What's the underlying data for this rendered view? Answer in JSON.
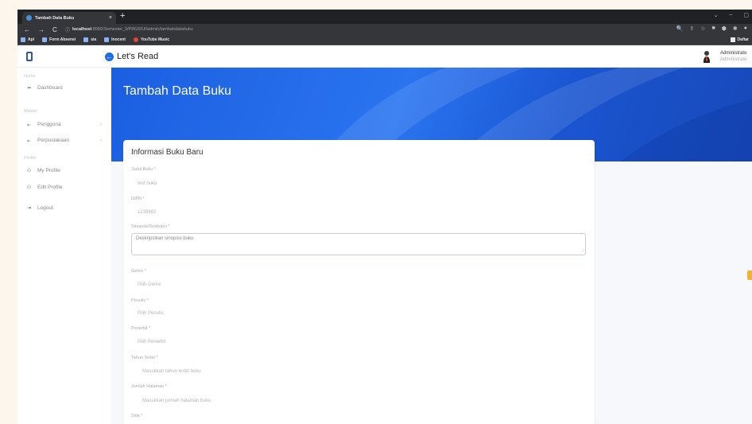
{
  "browser": {
    "tab_title": "Tambah Data Buku",
    "tab_close": "×",
    "new_tab": "+",
    "window_controls": [
      "⌄",
      "–",
      "▢"
    ],
    "nav": {
      "back": "←",
      "forward": "→",
      "reload": "C"
    },
    "url_info_icon": "ⓘ",
    "url_host": "localhost",
    "url_path": ":8080/Semester_3/PRG5/UI/admin/tambahdatabuku",
    "right_icons": [
      "🔍",
      "⇪",
      "☆",
      "■",
      "⬢",
      "✱",
      "●"
    ]
  },
  "bookmarks": {
    "items": [
      {
        "label": "Apl",
        "icon": "apps-grid-icon"
      },
      {
        "label": "Form Absensi",
        "icon": "bookmark-icon"
      },
      {
        "label": "sia",
        "icon": "bookmark-icon"
      },
      {
        "label": "Inocent",
        "icon": "bookmark-icon"
      },
      {
        "label": "YouTube Music",
        "icon": "youtube-music-icon"
      }
    ],
    "right_label": "Daftar"
  },
  "topbar": {
    "back_glyph": "←",
    "brand": "Let's Read",
    "user_name": "Administrato",
    "user_role": "Administrato"
  },
  "sidebar": {
    "sections": [
      {
        "title": "Home"
      },
      {
        "title": "Master"
      },
      {
        "title": "Profile"
      }
    ],
    "items": [
      {
        "label": "Dashboard",
        "icon": "dashboard-icon",
        "glyph": "▪▪",
        "chev": ""
      },
      {
        "label": "Pengguna",
        "icon": "users-icon",
        "glyph": "⁎.",
        "chev": "›"
      },
      {
        "label": "Perpustakaan",
        "icon": "library-icon",
        "glyph": "⁎.",
        "chev": "›"
      },
      {
        "label": "My Profile",
        "icon": "profile-icon",
        "glyph": "⚇",
        "chev": ""
      },
      {
        "label": "Edit Profile",
        "icon": "edit-profile-icon",
        "glyph": "⚇",
        "chev": ""
      },
      {
        "label": "Logout",
        "icon": "logout-icon",
        "glyph": "⇥",
        "chev": ""
      }
    ]
  },
  "hero": {
    "title": "Tambah Data Buku"
  },
  "form": {
    "title": "Informasi Buku Baru",
    "fields": [
      {
        "label": "Judul Buku *",
        "value": "test buku"
      },
      {
        "label": "ISBN *",
        "value": "1239682"
      },
      {
        "label": "Sinopsis/Deskripsi *",
        "value": "Deskripsikan sinopsis buku"
      },
      {
        "label": "Genre *",
        "value": "Pilih Genre"
      },
      {
        "label": "Penulis *",
        "value": "Pilih Penulis"
      },
      {
        "label": "Penerbit *",
        "value": "Pilih Penerbit"
      },
      {
        "label": "Tahun Terbit *",
        "value": "Masukkan tahun terbit buku"
      },
      {
        "label": "Jumlah Halaman *",
        "value": "Masukkan jumlah halaman buku"
      },
      {
        "label": "Stok *",
        "value": ""
      }
    ],
    "resize_glyph": "⟋"
  }
}
